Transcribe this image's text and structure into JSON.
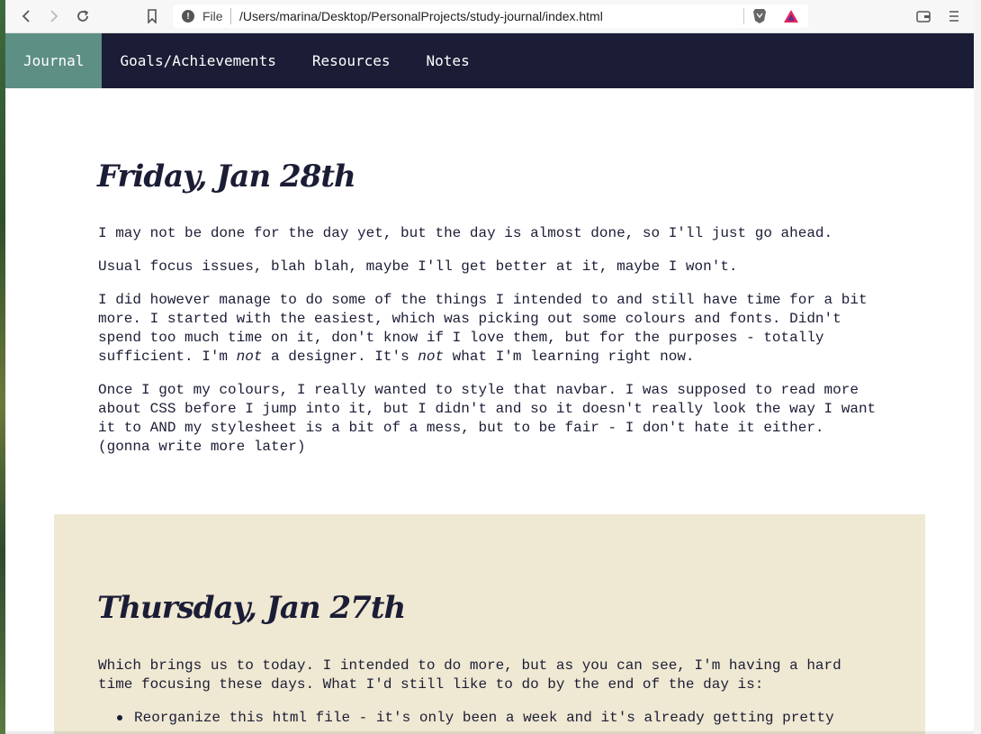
{
  "browser": {
    "url_scheme": "File",
    "url": "/Users/marina/Desktop/PersonalProjects/study-journal/index.html"
  },
  "navbar": {
    "items": [
      {
        "label": "Journal",
        "active": true
      },
      {
        "label": "Goals/Achievements",
        "active": false
      },
      {
        "label": "Resources",
        "active": false
      },
      {
        "label": "Notes",
        "active": false
      }
    ]
  },
  "entries": [
    {
      "title": "Friday, Jan 28th",
      "p1": "I may not be done for the day yet, but the day is almost done, so I'll just go ahead.",
      "p2": "Usual focus issues, blah blah, maybe I'll get better at it, maybe I won't.",
      "p3_lines": [
        "I did however manage to do some of the things I intended to and still have time for a bit",
        "more. I started with the easiest, which was picking out some colours and fonts. Didn't",
        "spend too much time on it, don't know if I love them, but for the purposes - totally"
      ],
      "p3_last_a": "sufficient. I'm ",
      "p3_em1": "not",
      "p3_last_b": " a designer. It's ",
      "p3_em2": "not",
      "p3_last_c": " what I'm learning right now.",
      "p4_lines": [
        "Once I got my colours, I really wanted to style that navbar. I was supposed to read more",
        "about CSS before I jump into it, but I didn't and so it doesn't really look the way I want",
        "it to AND my stylesheet is a bit of a mess, but to be fair - I don't hate it either.",
        "(gonna write more later)"
      ]
    },
    {
      "title": "Thursday, Jan 27th",
      "p1_lines": [
        "Which brings us to today. I intended to do more, but as you can see, I'm having a hard",
        "time focusing these days. What I'd still like to do by the end of the day is:"
      ],
      "todo_first": "Reorganize this html file - it's only been a week and it's already getting pretty"
    }
  ],
  "colors": {
    "navbar_bg": "#1b1d36",
    "navbar_active": "#5e8f84",
    "entry_alt_bg": "#efe8d2",
    "text": "#1b1d36"
  }
}
